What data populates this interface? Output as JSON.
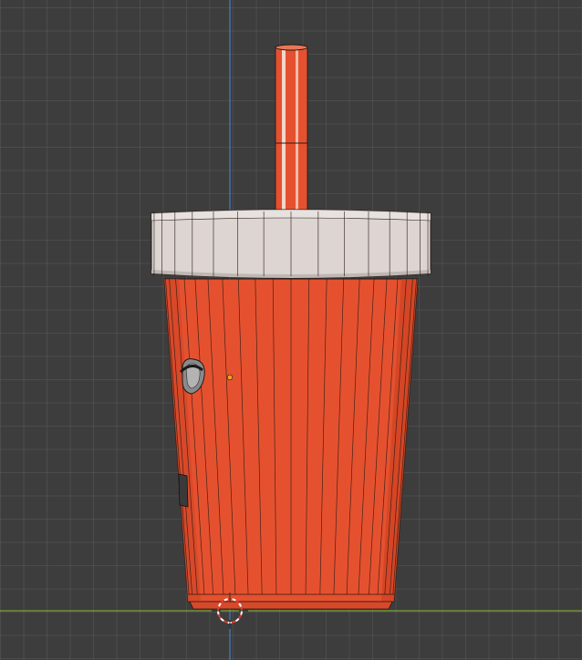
{
  "viewport": {
    "background": "#3d3d3d",
    "grid_color": "#4a4a4a",
    "axis_x_color": "#7aa33b",
    "axis_z_color": "#4a78c8"
  },
  "object": {
    "name": "cup",
    "body_color": "#e5512f",
    "body_shade": "#c8401f",
    "lid_color": "#dcd5d2",
    "lid_shade": "#bfb7b3",
    "straw_color": "#e5512f",
    "straw_stripe": "#f0c9bd",
    "wire_color": "#2a1a14",
    "handle_color": "#3a3a3a"
  },
  "icons": {
    "cursor": "3d-cursor-icon",
    "origin": "object-origin-icon"
  }
}
